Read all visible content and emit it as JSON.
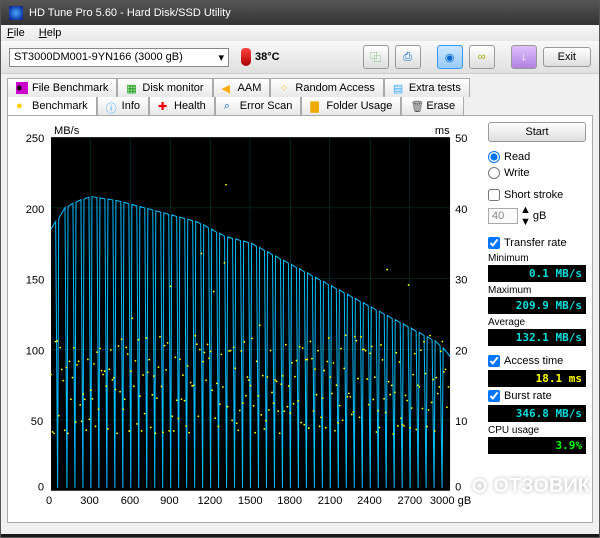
{
  "window": {
    "title": "HD Tune Pro 5.60 - Hard Disk/SSD Utility"
  },
  "menu": {
    "file": "File",
    "help": "Help"
  },
  "toolbar": {
    "drive": "ST3000DM001-9YN166 (3000 gB)",
    "temp": "38°C",
    "exit": "Exit"
  },
  "tabs_upper": [
    {
      "label": "File Benchmark"
    },
    {
      "label": "Disk monitor"
    },
    {
      "label": "AAM"
    },
    {
      "label": "Random Access"
    },
    {
      "label": "Extra tests"
    }
  ],
  "tabs_lower": [
    {
      "label": "Benchmark"
    },
    {
      "label": "Info"
    },
    {
      "label": "Health"
    },
    {
      "label": "Error Scan"
    },
    {
      "label": "Folder Usage"
    },
    {
      "label": "Erase"
    }
  ],
  "sidebar": {
    "start": "Start",
    "read": "Read",
    "write": "Write",
    "short_stroke": "Short stroke",
    "stroke_val": "40",
    "stroke_unit": "gB",
    "transfer_rate": "Transfer rate",
    "minimum_label": "Minimum",
    "minimum_val": "0.1 MB/s",
    "maximum_label": "Maximum",
    "maximum_val": "209.9 MB/s",
    "average_label": "Average",
    "average_val": "132.1 MB/s",
    "access_label": "Access time",
    "access_val": "18.1 ms",
    "burst_label": "Burst rate",
    "burst_val": "346.8 MB/s",
    "cpu_label": "CPU usage",
    "cpu_val": "3.9%"
  },
  "chart_data": {
    "type": "line",
    "xlabel": "gB",
    "ylabel_left": "MB/s",
    "ylabel_right": "ms",
    "xlim": [
      0,
      3000
    ],
    "ylim_left": [
      0,
      250
    ],
    "ylim_right": [
      0,
      50
    ],
    "x_ticks": [
      0,
      300,
      600,
      900,
      1200,
      1500,
      1800,
      2100,
      2400,
      2700,
      3000
    ],
    "y_ticks_left": [
      0,
      50,
      100,
      150,
      200,
      250
    ],
    "y_ticks_right": [
      0,
      10,
      20,
      30,
      40,
      50
    ],
    "series": [
      {
        "name": "Transfer rate (MB/s)",
        "type": "line",
        "color": "#00bfff",
        "envelope_high": [
          [
            0,
            185
          ],
          [
            100,
            200
          ],
          [
            200,
            205
          ],
          [
            300,
            208
          ],
          [
            500,
            205
          ],
          [
            700,
            200
          ],
          [
            900,
            195
          ],
          [
            1100,
            190
          ],
          [
            1300,
            180
          ],
          [
            1500,
            175
          ],
          [
            1700,
            165
          ],
          [
            1900,
            155
          ],
          [
            2100,
            145
          ],
          [
            2300,
            135
          ],
          [
            2500,
            125
          ],
          [
            2700,
            115
          ],
          [
            2900,
            105
          ],
          [
            3000,
            95
          ]
        ],
        "dropouts_to_near_zero_at_x": [
          50,
          120,
          180,
          240,
          300,
          360,
          420,
          480,
          540,
          600,
          660,
          720,
          780,
          840,
          900,
          960,
          1020,
          1080,
          1140,
          1200,
          1260,
          1320,
          1380,
          1440,
          1500,
          1560,
          1620,
          1680,
          1740,
          1800,
          1860,
          1920,
          1980,
          2040,
          2100,
          2160,
          2220,
          2280,
          2340,
          2400,
          2460,
          2520,
          2580,
          2640,
          2700,
          2760,
          2820,
          2880,
          2940
        ],
        "note": "Sawtooth pattern: repeated sharp drops from envelope_high down to ~0.1 MB/s at many x positions across the whole span"
      },
      {
        "name": "Access time (ms)",
        "type": "scatter",
        "color": "#ffff00",
        "cluster_band_ms": [
          8,
          22
        ],
        "outliers_ms_approx": [
          3,
          4,
          5,
          28,
          30,
          34,
          36,
          40,
          42,
          45
        ],
        "note": "Yellow dots scattered across full x-range, mostly clustered between 8–22 ms with occasional higher outliers"
      }
    ]
  }
}
